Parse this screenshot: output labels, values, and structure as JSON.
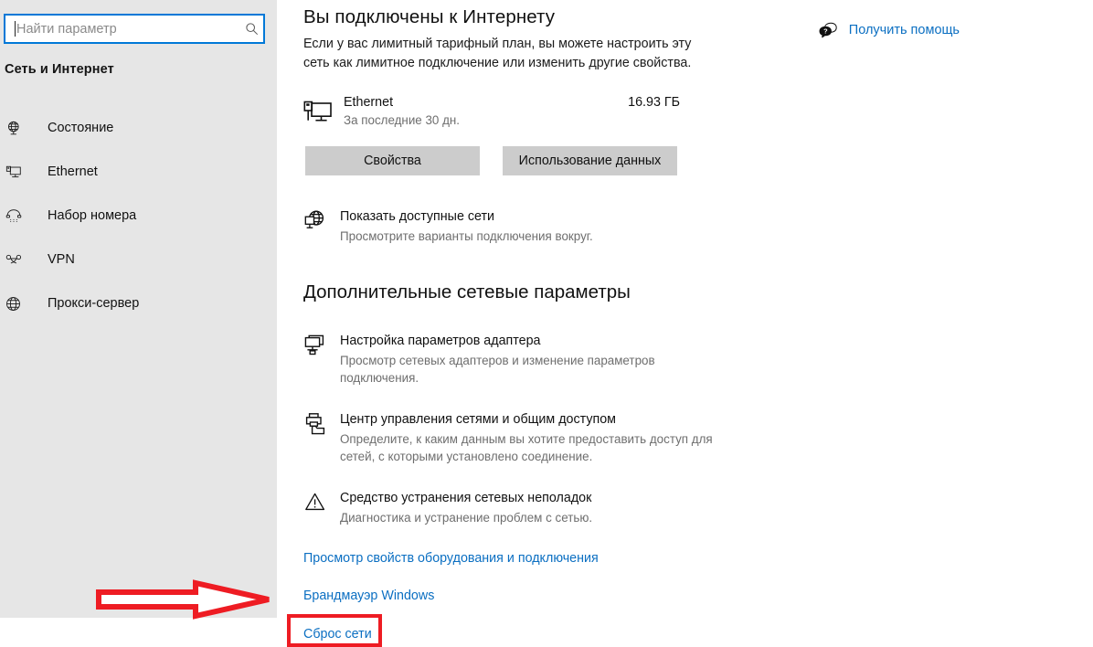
{
  "sidebar": {
    "search": {
      "placeholder": "Найти параметр",
      "value": "",
      "icon": "search-icon"
    },
    "title": "Сеть и Интернет",
    "items": [
      {
        "label": "Состояние",
        "icon": "globe-stand-icon"
      },
      {
        "label": "Ethernet",
        "icon": "monitor-icon"
      },
      {
        "label": "Набор номера",
        "icon": "phone-handset-icon"
      },
      {
        "label": "VPN",
        "icon": "vpn-key-icon"
      },
      {
        "label": "Прокси-сервер",
        "icon": "globe-icon"
      }
    ]
  },
  "main": {
    "help": {
      "label": "Получить помощь",
      "icon": "help-bubble-icon"
    },
    "status": {
      "heading": "Вы подключены к Интернету",
      "description": "Если у вас лимитный тарифный план, вы можете настроить эту сеть как лимитное подключение или изменить другие свойства."
    },
    "connection": {
      "icon": "pc-monitor-icon",
      "name": "Ethernet",
      "period": "За последние 30 дн.",
      "usage": "16.93 ГБ"
    },
    "buttons": {
      "properties": "Свойства",
      "data_usage": "Использование данных"
    },
    "show_networks": {
      "icon": "globe-stand-icon",
      "title": "Показать доступные сети",
      "description": "Просмотрите варианты подключения вокруг."
    },
    "advanced_heading": "Дополнительные сетевые параметры",
    "advanced_items": [
      {
        "icon": "adapters-icon",
        "title": "Настройка параметров адаптера",
        "description": "Просмотр сетевых адаптеров и изменение параметров подключения."
      },
      {
        "icon": "sharing-center-icon",
        "title": "Центр управления сетями и общим доступом",
        "description": "Определите, к каким данным вы хотите предоставить доступ для сетей, с которыми установлено соединение."
      },
      {
        "icon": "warning-triangle-icon",
        "title": "Средство устранения сетевых неполадок",
        "description": "Диагностика и устранение проблем с сетью."
      }
    ],
    "links": [
      {
        "label": "Просмотр свойств оборудования и подключения"
      },
      {
        "label": "Брандмауэр Windows"
      },
      {
        "label": "Сброс сети",
        "highlighted": true
      }
    ]
  },
  "annotation": {
    "arrow": "red-arrow-pointing-right",
    "highlight_color": "#ee1c23",
    "target": "Сброс сети"
  },
  "colors": {
    "accent_link": "#0b6fc2",
    "sidebar_bg": "#e6e6e6",
    "button_bg": "#cccccc",
    "focus_border": "#0078d7",
    "annotation_red": "#ee1c23"
  }
}
